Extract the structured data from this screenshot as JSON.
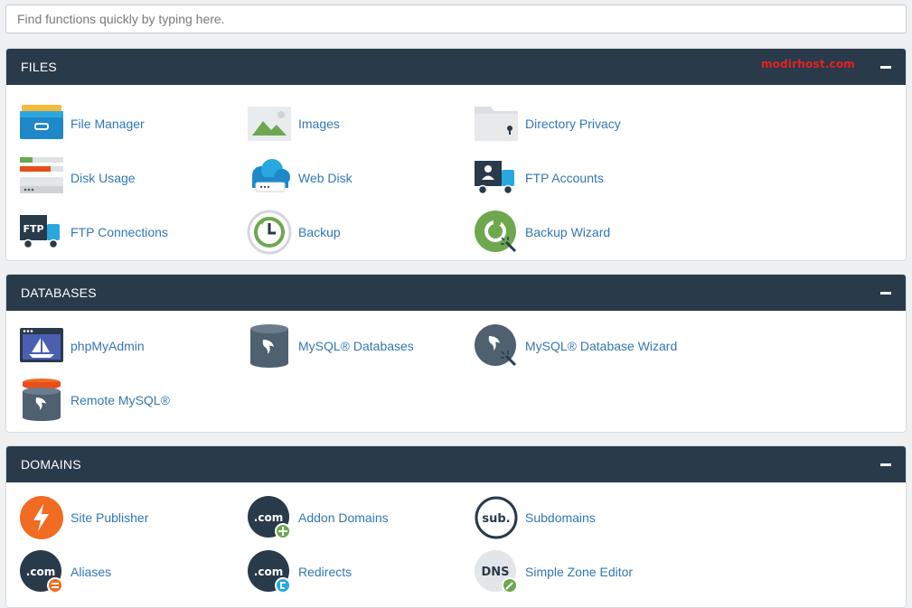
{
  "search": {
    "placeholder": "Find functions quickly by typing here."
  },
  "brand": "modirhost.com",
  "files": {
    "title": "FILES",
    "items": [
      {
        "label": "File Manager"
      },
      {
        "label": "Images"
      },
      {
        "label": "Directory Privacy"
      },
      {
        "label": "Disk Usage"
      },
      {
        "label": "Web Disk"
      },
      {
        "label": "FTP Accounts"
      },
      {
        "label": "FTP Connections"
      },
      {
        "label": "Backup"
      },
      {
        "label": "Backup Wizard"
      }
    ]
  },
  "databases": {
    "title": "DATABASES",
    "items": [
      {
        "label": "phpMyAdmin"
      },
      {
        "label": "MySQL® Databases"
      },
      {
        "label": "MySQL® Database Wizard"
      },
      {
        "label": "Remote MySQL®"
      }
    ]
  },
  "domains": {
    "title": "DOMAINS",
    "items": [
      {
        "label": "Site Publisher"
      },
      {
        "label": "Addon Domains"
      },
      {
        "label": "Subdomains"
      },
      {
        "label": "Aliases"
      },
      {
        "label": "Redirects"
      },
      {
        "label": "Simple Zone Editor"
      }
    ]
  },
  "icon_text": {
    "ftp": "FTP",
    "com": ".com",
    "sub": "sub.",
    "dns": "DNS"
  },
  "colors": {
    "header": "#293a4a",
    "link": "#3277b3",
    "brand": "#e8211d"
  }
}
